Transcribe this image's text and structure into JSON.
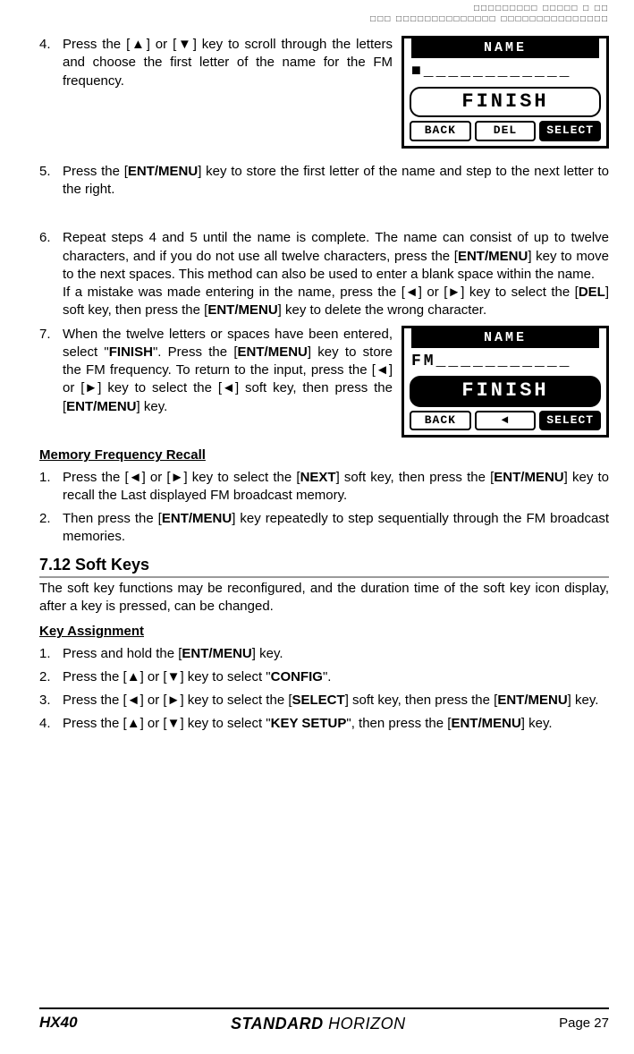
{
  "crops": {
    "line1": "□□□□□□□□□ □□□□□ □ □□",
    "line2": "□□□ □□□□□□□□□□□□□□ □□□□□□□□□□□□□□□"
  },
  "step4": {
    "num": "4.",
    "text_a": "Press the [",
    "up": "▲",
    "text_b": "] or [",
    "down": "▼",
    "text_c": "] key to scroll through the letters and choose the first letter of the name for the FM frequency."
  },
  "lcd1": {
    "title": "NAME",
    "name": "■____________",
    "finish": "FINISH",
    "sk1": "BACK",
    "sk2": "DEL",
    "sk3": "SELECT"
  },
  "step5": {
    "num": "5.",
    "text_a": "Press the [",
    "ent": "ENT/MENU",
    "text_b": "] key to store the first letter of the name and step to the next letter to the right."
  },
  "step6": {
    "num": "6.",
    "p1_a": "Repeat steps 4 and 5 until the name is complete. The name can consist of up to twelve characters, and if you do not use all twelve characters, press the [",
    "ent": "ENT/MENU",
    "p1_b": "] key to move to the next spaces. This method can also be used to enter a blank space within the name.",
    "p2_a": "If a mistake was made entering in the name, press the [",
    "left": "◄",
    "p2_b": "] or [",
    "right": "►",
    "p2_c": "] key to select the [",
    "del": "DEL",
    "p2_d": "] soft key, then press the [",
    "p2_e": "] key to delete the wrong character."
  },
  "step7": {
    "num": "7.",
    "a": "When the twelve letters or spaces have been entered, select \"",
    "finish": "FINISH",
    "b": "\". Press the [",
    "ent": "ENT/MENU",
    "c": "] key to store the FM frequency.",
    "d": "To return to the input, press the [",
    "left": "◄",
    "e": "] or [",
    "right": "►",
    "f": "] key to select the [",
    "tri": "◄",
    "g": "] soft key, then press the [",
    "h": "] key."
  },
  "lcd2": {
    "title": "NAME",
    "name": "FM___________",
    "finish": "FINISH",
    "sk1": "BACK",
    "sk2": "◄",
    "sk3": "SELECT"
  },
  "mem_title": "Memory Frequency Recall",
  "mem1": {
    "num": "1.",
    "a": "Press the [",
    "left": "◄",
    "b": "] or [",
    "right": "►",
    "c": "] key to select the [",
    "next": "NEXT",
    "d": "] soft key, then press the [",
    "ent": "ENT/MENU",
    "e": "] key to recall the Last displayed FM broadcast memory."
  },
  "mem2": {
    "num": "2.",
    "a": "Then press the [",
    "ent": "ENT/MENU",
    "b": "] key repeatedly to step sequentially through the FM broadcast memories."
  },
  "h712": "7.12 Soft Keys",
  "h712_p": "The soft key functions may be reconfigured, and the duration time of the soft key icon display, after a key is pressed, can be changed.",
  "ka_title": "Key Assignment",
  "ka1": {
    "num": "1.",
    "a": "Press and hold the [",
    "ent": "ENT/MENU",
    "b": "] key."
  },
  "ka2": {
    "num": "2.",
    "a": "Press the [",
    "up": "▲",
    "b": "] or [",
    "down": "▼",
    "c": "] key to select \"",
    "config": "CONFIG",
    "d": "\"."
  },
  "ka3": {
    "num": "3.",
    "a": "Press the [",
    "left": "◄",
    "b": "] or [",
    "right": "►",
    "c": "] key to select the [",
    "select": "SELECT",
    "d": "] soft key, then press the [",
    "ent": "ENT/MENU",
    "e": "] key."
  },
  "ka4": {
    "num": "4.",
    "a": "Press the [",
    "up": "▲",
    "b": "] or [",
    "down": "▼",
    "c": "] key to select \"",
    "ks": "KEY SETUP",
    "d": "\", then press the [",
    "ent": "ENT/MENU",
    "e": "] key."
  },
  "footer": {
    "model": "HX40",
    "brand1": "STANDARD",
    "brand2": "HORIZON",
    "page": "Page 27"
  }
}
